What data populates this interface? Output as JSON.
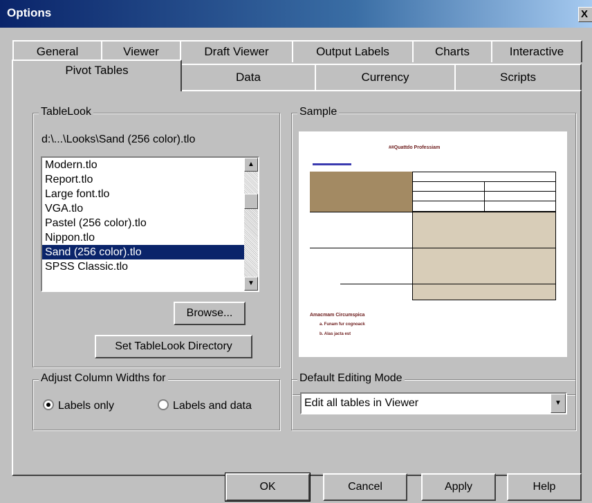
{
  "window": {
    "title": "Options",
    "close_glyph": "X"
  },
  "tabs_row1": [
    "General",
    "Viewer",
    "Draft Viewer",
    "Output Labels",
    "Charts",
    "Interactive"
  ],
  "tabs_row2": [
    "Pivot Tables",
    "Data",
    "Currency",
    "Scripts"
  ],
  "active_tab": "Pivot Tables",
  "tablelook": {
    "group_label": "TableLook",
    "path": "d:\\...\\Looks\\Sand (256 color).tlo",
    "items": [
      "Modern.tlo",
      "Report.tlo",
      "Large font.tlo",
      "VGA.tlo",
      "Pastel (256 color).tlo",
      "Nippon.tlo",
      "Sand (256 color).tlo",
      "SPSS Classic.tlo"
    ],
    "selected": "Sand (256 color).tlo",
    "browse_button": "Browse...",
    "set_dir_button": "Set TableLook Directory"
  },
  "sample": {
    "group_label": "Sample",
    "table_title": "##Quattdo Professiam",
    "footnote_title": "Amacmam Circumspica",
    "footnote_a": "a. Funam fur cognoack",
    "footnote_b": "b. Alas jacta est",
    "colors": {
      "header_fill": "#a38a63",
      "body_fill": "#d8cdb8",
      "text_dark": "#6b1a1a"
    }
  },
  "adjust": {
    "group_label": "Adjust Column Widths for",
    "option1": "Labels only",
    "option2": "Labels and data",
    "selected": "Labels only"
  },
  "editing": {
    "group_label": "Default Editing Mode",
    "value": "Edit all tables in Viewer"
  },
  "buttons": {
    "ok": "OK",
    "cancel": "Cancel",
    "apply": "Apply",
    "help": "Help"
  }
}
